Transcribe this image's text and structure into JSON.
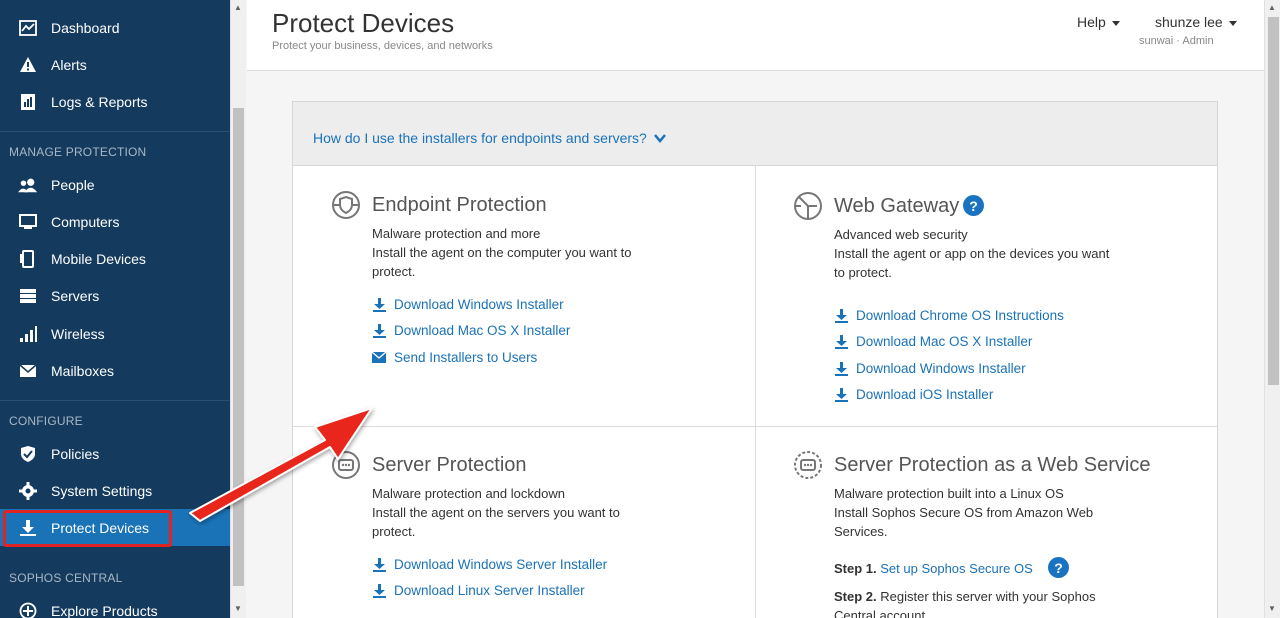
{
  "sidebar": {
    "items_top": [
      {
        "label": "Dashboard",
        "icon": "dashboard-icon"
      },
      {
        "label": "Alerts",
        "icon": "alert-icon"
      },
      {
        "label": "Logs & Reports",
        "icon": "reports-icon"
      }
    ],
    "manage_label": "MANAGE PROTECTION",
    "manage_items": [
      {
        "label": "People",
        "icon": "people-icon"
      },
      {
        "label": "Computers",
        "icon": "computer-icon"
      },
      {
        "label": "Mobile Devices",
        "icon": "mobile-icon"
      },
      {
        "label": "Servers",
        "icon": "server-icon"
      },
      {
        "label": "Wireless",
        "icon": "wireless-icon"
      },
      {
        "label": "Mailboxes",
        "icon": "mail-icon"
      }
    ],
    "configure_label": "CONFIGURE",
    "configure_items": [
      {
        "label": "Policies",
        "icon": "shield-icon"
      },
      {
        "label": "System Settings",
        "icon": "gear-icon"
      },
      {
        "label": "Protect Devices",
        "icon": "download-icon",
        "active": true
      }
    ],
    "central_label": "SOPHOS CENTRAL",
    "central_items": [
      {
        "label": "Explore Products",
        "icon": "plus-circle-icon"
      }
    ]
  },
  "header": {
    "title": "Protect Devices",
    "subtitle": "Protect your business, devices, and networks",
    "help_label": "Help",
    "user_name": "shunze lee",
    "user_org": "sunwai · Admin"
  },
  "main": {
    "how_link": "How do I use the installers for endpoints and servers?",
    "endpoint": {
      "title": "Endpoint Protection",
      "desc1": "Malware protection and more",
      "desc2": "Install the agent on the computer you want to",
      "desc3": "protect.",
      "links": [
        "Download Windows Installer",
        "Download Mac OS X Installer",
        "Send Installers to Users"
      ]
    },
    "web_gateway": {
      "title": "Web Gateway",
      "desc1": "Advanced web security",
      "desc2": "Install the agent or app on the devices you want",
      "desc3": "to protect.",
      "links": [
        "Download Chrome OS Instructions",
        "Download Mac OS X Installer",
        "Download Windows Installer",
        "Download iOS Installer"
      ]
    },
    "server": {
      "title": "Server Protection",
      "desc1": "Malware protection and lockdown",
      "desc2": "Install the agent on the servers you want to",
      "desc3": "protect.",
      "links": [
        "Download Windows Server Installer",
        "Download Linux Server Installer"
      ]
    },
    "server_web": {
      "title": "Server Protection as a Web Service",
      "desc1": "Malware protection built into a Linux OS",
      "desc2": "Install Sophos Secure OS from Amazon Web",
      "desc3": "Services.",
      "step1_label": "Step 1.",
      "step1_link": "Set up Sophos Secure OS",
      "step2_label": "Step 2.",
      "step2_text": "Register this server with your Sophos",
      "step2_text2": "Central account"
    }
  },
  "colors": {
    "sidebar_bg": "#143b5e",
    "active_bg": "#1a73b7",
    "link": "#1a72b8",
    "annotation_red": "#e02424"
  }
}
